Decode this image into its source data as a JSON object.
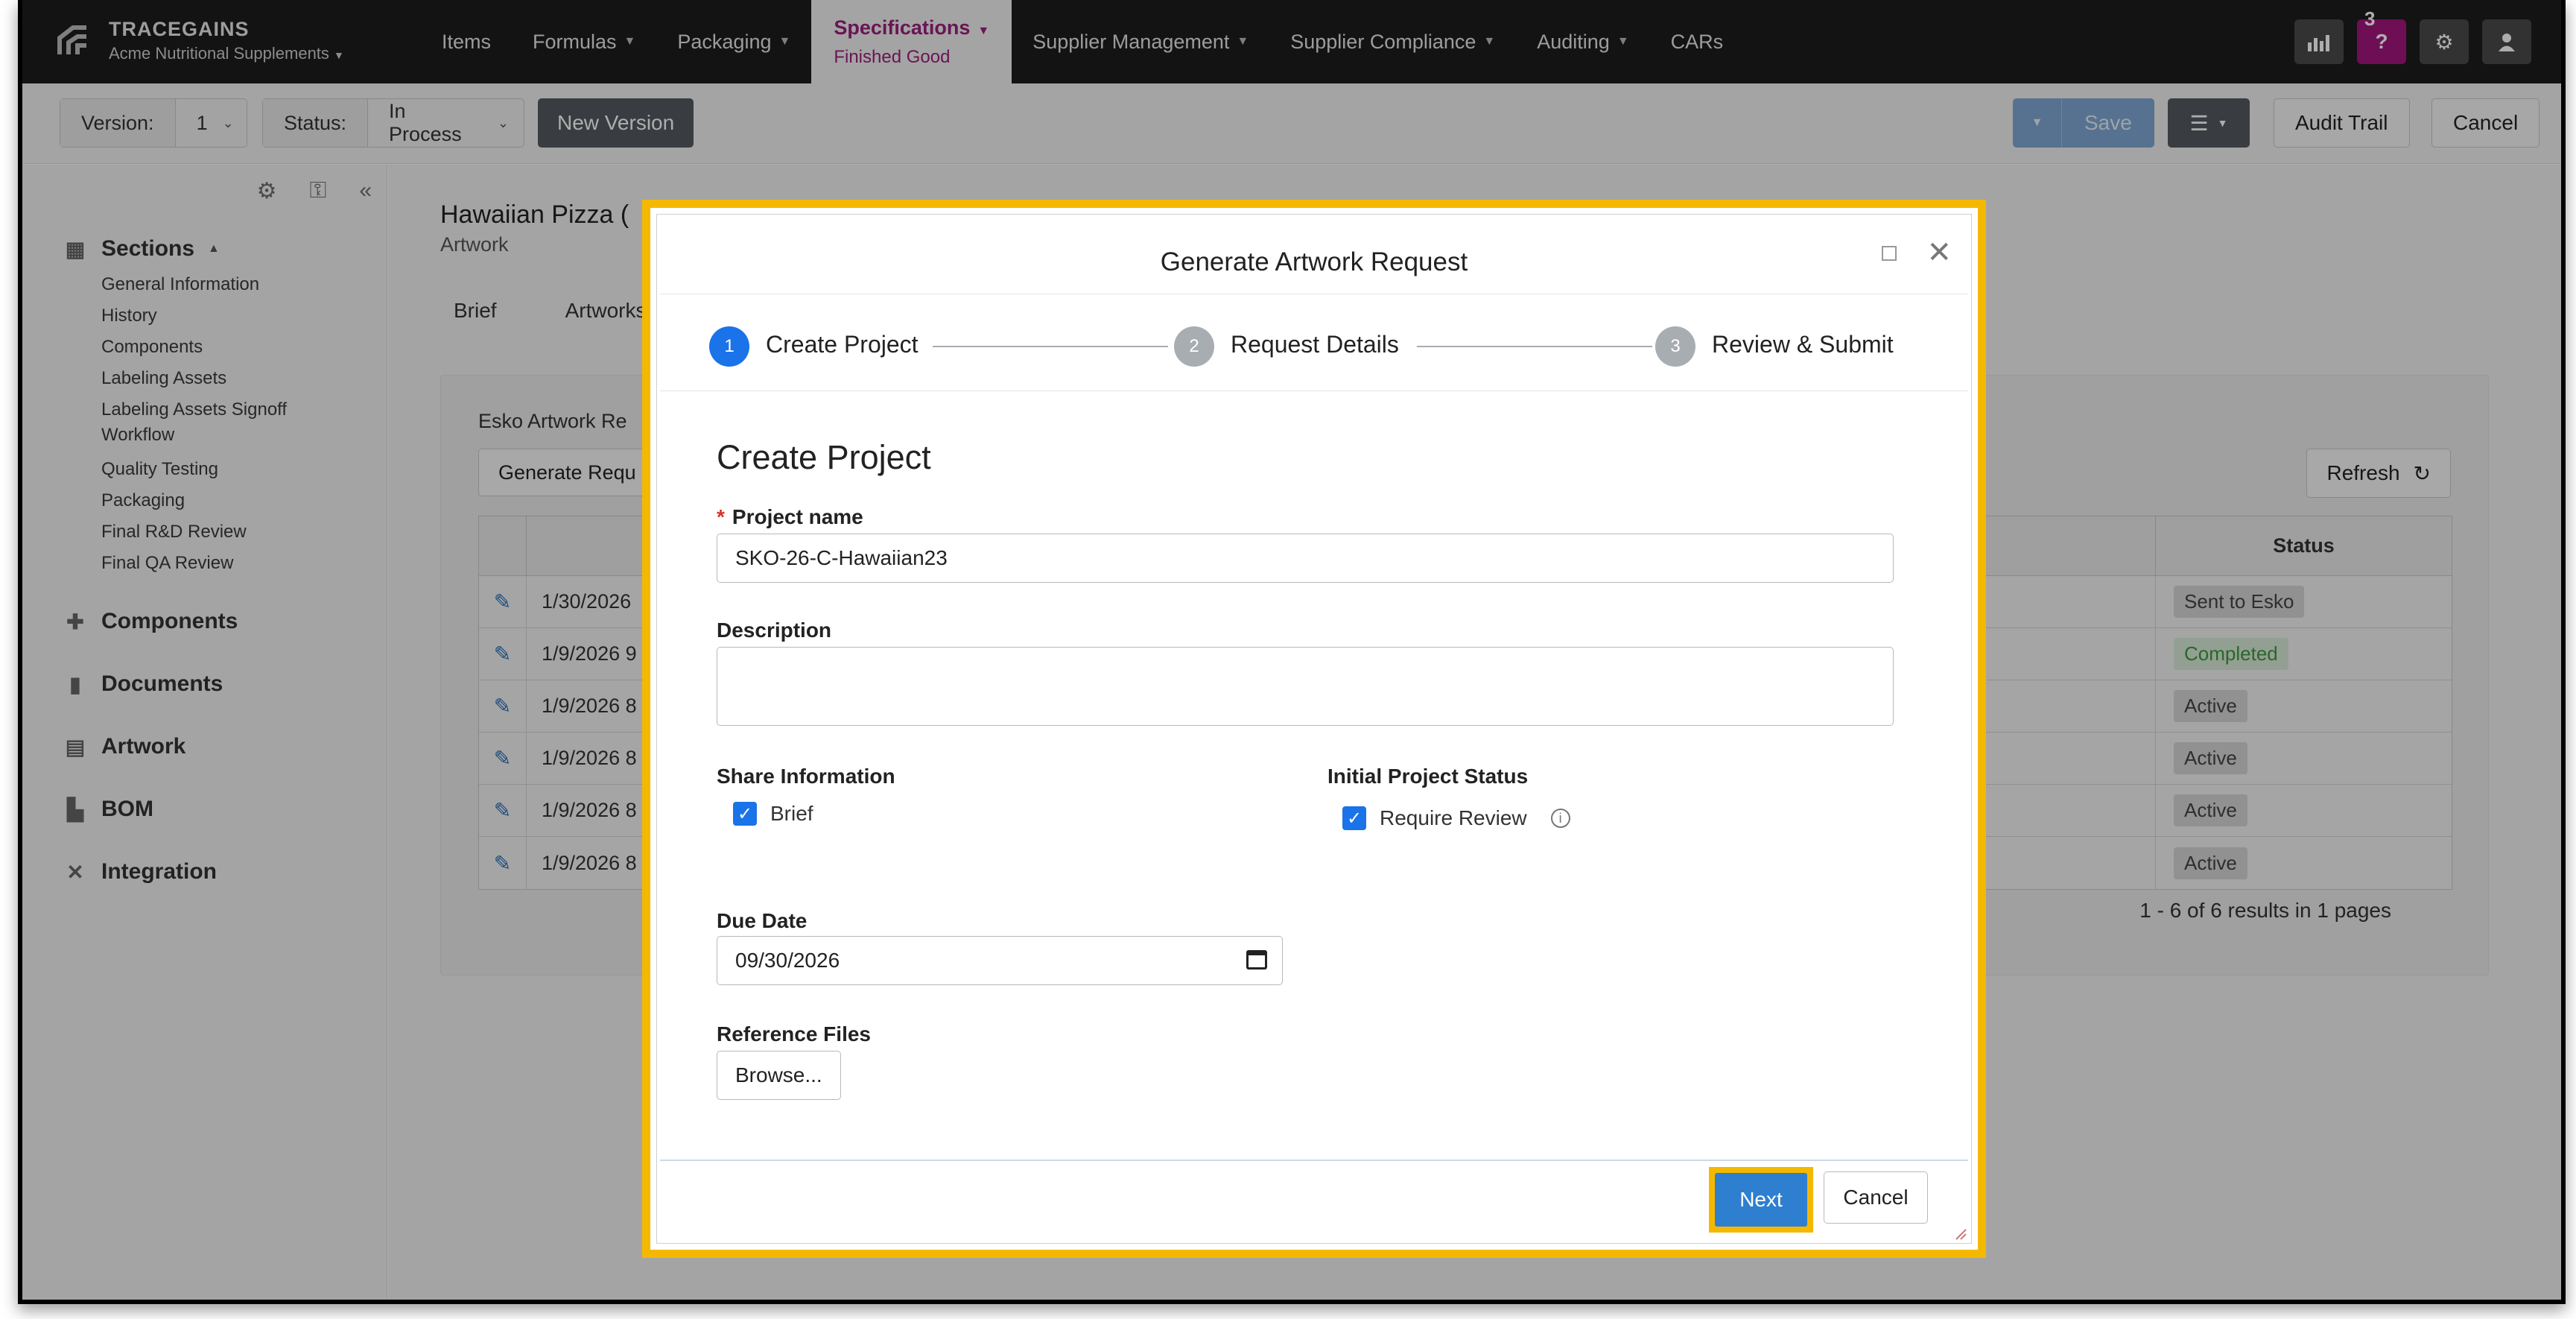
{
  "brand": {
    "name": "TRACEGAINS",
    "org": "Acme Nutritional Supplements"
  },
  "nav": {
    "items": [
      "Items",
      "Formulas",
      "Packaging"
    ],
    "active": {
      "title": "Specifications",
      "sub": "Finished Good"
    },
    "items_after": [
      "Supplier Management",
      "Supplier Compliance",
      "Auditing",
      "CARs"
    ],
    "notification_count": "3",
    "help_label": "?"
  },
  "toolbar": {
    "version_label": "Version:",
    "version_value": "1",
    "status_label": "Status:",
    "status_value": "In Process",
    "new_version": "New Version",
    "save": "Save",
    "audit_trail": "Audit Trail",
    "cancel": "Cancel"
  },
  "sidebar": {
    "sections_label": "Sections",
    "section_links": [
      "General Information",
      "History",
      "Components",
      "Labeling Assets",
      "Labeling Assets Signoff Workflow",
      "Quality Testing",
      "Packaging",
      "Final R&D Review",
      "Final QA Review"
    ],
    "groups": [
      "Components",
      "Documents",
      "Artwork",
      "BOM",
      "Integration"
    ]
  },
  "main": {
    "title": "Hawaiian Pizza (",
    "subtitle": "Artwork",
    "tabs": [
      "Brief",
      "Artworks"
    ],
    "panel_title": "Esko Artwork Re",
    "generate_button": "Generate Requ",
    "refresh": "Refresh",
    "status_header": "Status",
    "rows": [
      {
        "date": "1/30/2026",
        "status": "Sent to Esko"
      },
      {
        "date": "1/9/2026 9",
        "status": "Completed"
      },
      {
        "date": "1/9/2026 8",
        "status": "Active"
      },
      {
        "date": "1/9/2026 8",
        "status": "Active"
      },
      {
        "date": "1/9/2026 8",
        "status": "Active"
      },
      {
        "date": "1/9/2026 8",
        "status": "Active"
      }
    ],
    "pager": "1 - 6 of 6 results in 1 pages"
  },
  "modal": {
    "title": "Generate Artwork Request",
    "steps": [
      {
        "num": "1",
        "label": "Create Project"
      },
      {
        "num": "2",
        "label": "Request Details"
      },
      {
        "num": "3",
        "label": "Review & Submit"
      }
    ],
    "section_title": "Create Project",
    "project_name_label": "Project name",
    "project_name_value": "SKO-26-C-Hawaiian23",
    "description_label": "Description",
    "share_label": "Share Information",
    "share_brief": "Brief",
    "initial_status_label": "Initial Project Status",
    "require_review": "Require Review",
    "due_date_label": "Due Date",
    "due_date_value": "09/30/2026",
    "reference_files_label": "Reference Files",
    "browse": "Browse...",
    "next": "Next",
    "cancel": "Cancel"
  },
  "colors": {
    "accent": "#1a73e8",
    "highlight": "#f5b800",
    "brand_magenta": "#a2157e",
    "nav_bg": "#1c1c1c"
  }
}
